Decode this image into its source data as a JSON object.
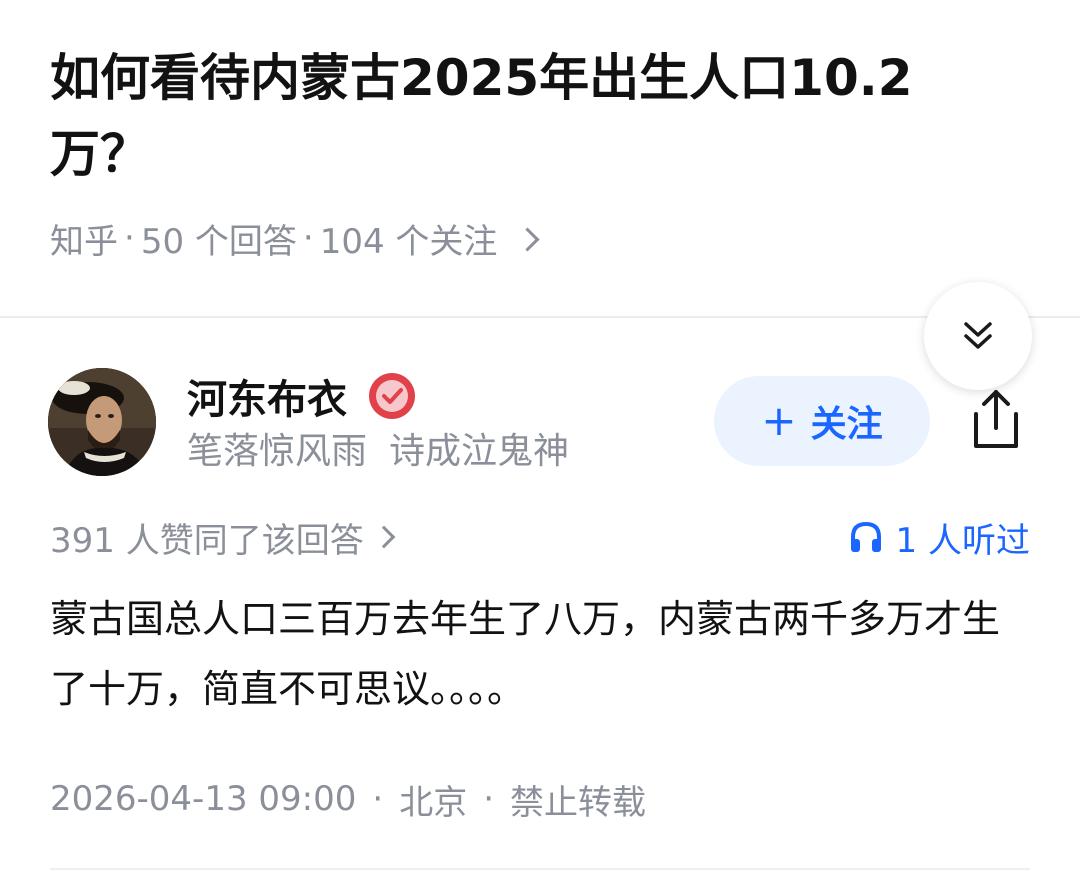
{
  "question": {
    "title": "如何看待内蒙古2025年出生人口10.2万？",
    "source": "知乎",
    "answer_count": "50 个回答",
    "follower_count": "104 个关注"
  },
  "author": {
    "name": "河东布衣",
    "bio_part1": "笔落惊风雨",
    "bio_part2": "诗成泣鬼神",
    "follow_label": "关注",
    "avatar_icon": "portrait-avatar",
    "badge_icon": "verified-badge-icon"
  },
  "answer": {
    "upvote_text": "391 人赞同了该回答",
    "listen_text": "1 人听过",
    "content": "蒙古国总人口三百万去年生了八万，内蒙古两千多万才生了十万，简直不可思议。。。。",
    "datetime": "2026-04-13 09:00",
    "location": "北京",
    "copyright": "禁止转载"
  },
  "colors": {
    "accent": "#1a66ff",
    "follow_bg": "#ebf3fe",
    "muted_text": "#8a8f99",
    "badge_red": "#e0414a"
  }
}
